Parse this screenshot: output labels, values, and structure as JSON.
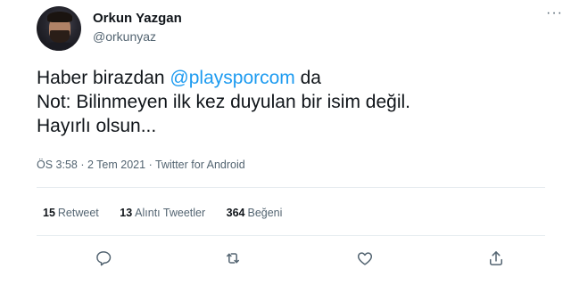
{
  "author": {
    "name": "Orkun Yazgan",
    "handle": "@orkunyaz"
  },
  "tweet": {
    "line1_prefix": "Haber birazdan ",
    "mention": "@playsporcom",
    "line1_suffix": " da",
    "line2": "Not: Bilinmeyen ilk kez duyulan bir isim değil.",
    "line3": "Hayırlı olsun..."
  },
  "meta": {
    "time": "ÖS 3:58",
    "sep1": " · ",
    "date": "2 Tem 2021",
    "sep2": " · ",
    "source": "Twitter for Android"
  },
  "stats": {
    "retweets_count": "15",
    "retweets_label": "Retweet",
    "quotes_count": "13",
    "quotes_label": "Alıntı Tweetler",
    "likes_count": "364",
    "likes_label": "Beğeni"
  },
  "more_glyph": "···",
  "icons": {
    "reply": "reply-icon",
    "retweet": "retweet-icon",
    "like": "heart-icon",
    "share": "share-icon"
  },
  "colors": {
    "accent": "#1d9bf0",
    "text": "#0f1419",
    "secondary": "#536471",
    "divider": "#e6ecf0"
  }
}
